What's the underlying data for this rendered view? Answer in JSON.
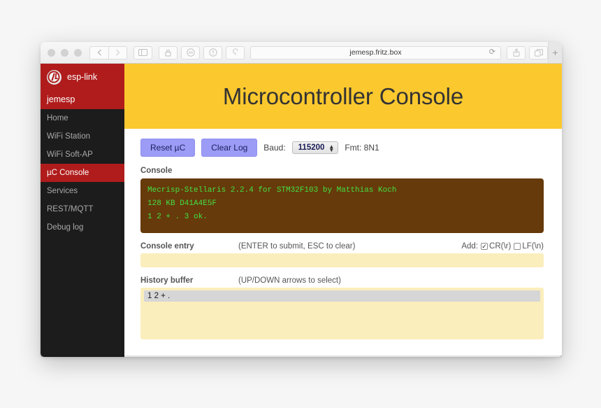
{
  "browser": {
    "traffic_lights": [
      "close",
      "minimize",
      "zoom"
    ],
    "nav": {
      "back_icon": "chevron-left-icon",
      "forward_icon": "chevron-right-icon"
    },
    "sidebar_toggle_icon": "sidebar-icon",
    "extension_icons": [
      "lock-icon",
      "adblock-icon",
      "info-icon",
      "pocket-icon"
    ],
    "url": "jemesp.fritz.box",
    "reload_icon": "reload-icon",
    "share_icon": "share-icon",
    "tabs_icon": "tabs-icon",
    "new_tab_label": "+"
  },
  "sidebar": {
    "brand": "esp-link",
    "logo_icon": "esp-link-logo-icon",
    "account": "jemesp",
    "items": [
      {
        "label": "Home",
        "active": false
      },
      {
        "label": "WiFi Station",
        "active": false
      },
      {
        "label": "WiFi Soft-AP",
        "active": false
      },
      {
        "label": "µC Console",
        "active": true
      },
      {
        "label": "Services",
        "active": false
      },
      {
        "label": "REST/MQTT",
        "active": false
      },
      {
        "label": "Debug log",
        "active": false
      }
    ],
    "colors": {
      "background": "#1c1c1c",
      "accent": "#b01c1c",
      "text": "#a9a9a9"
    }
  },
  "banner": {
    "title": "Microcontroller Console",
    "background": "#fbc82e"
  },
  "toolbar": {
    "reset_label": "Reset µC",
    "clear_label": "Clear Log",
    "baud_label": "Baud:",
    "baud_value": "115200",
    "stepper_icon": "stepper-updown-icon",
    "fmt_label": "Fmt: 8N1",
    "button_color": "#9c9cf7"
  },
  "console": {
    "heading": "Console",
    "background": "#663a0a",
    "text_color": "#44e044",
    "lines": [
      "Mecrisp-Stellaris 2.2.4 for STM32F103 by Matthias Koch",
      "128 KB  D41A4E5F",
      "1 2 + . 3  ok."
    ]
  },
  "console_entry": {
    "heading": "Console entry",
    "hint": "(ENTER to submit, ESC to clear)",
    "add_label": "Add:",
    "options": [
      {
        "label": "CR(\\r)",
        "checked": true
      },
      {
        "label": "LF(\\n)",
        "checked": false
      }
    ],
    "value": "",
    "placeholder": "",
    "background": "#fbeebd"
  },
  "history": {
    "heading": "History buffer",
    "hint": "(UP/DOWN arrows to select)",
    "entries": [
      "1 2 + ."
    ],
    "background": "#fbeebd",
    "selected_background": "#d6d6d6"
  }
}
